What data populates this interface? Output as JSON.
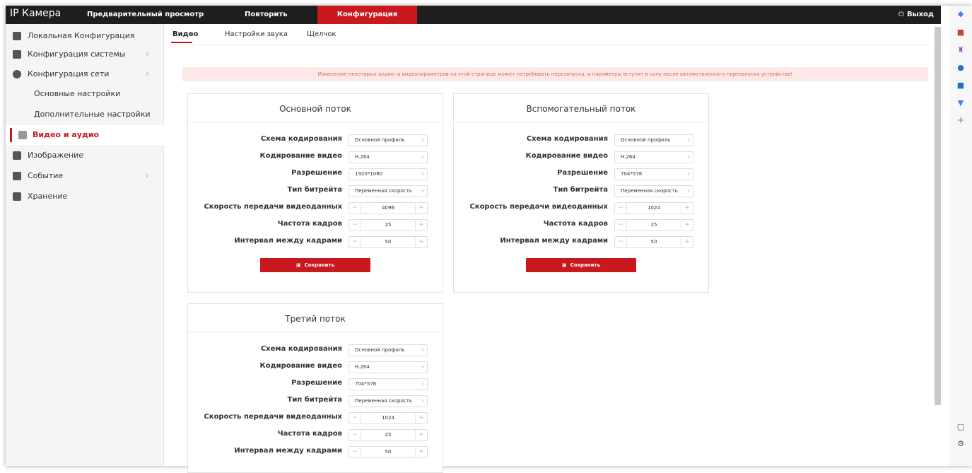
{
  "header": {
    "app_title": "IP Камера",
    "nav": {
      "preview": "Предварительный просмотр",
      "playback": "Повторить",
      "config": "Конфигурация"
    },
    "logout_label": "Выход",
    "logout_icon": "power-icon"
  },
  "sidebar": {
    "items": [
      {
        "label": "Локальная Конфигурация",
        "icon": "monitor-icon"
      },
      {
        "label": "Конфигурация системы",
        "icon": "system-icon"
      },
      {
        "label": "Конфигурация сети",
        "icon": "globe-icon"
      },
      {
        "label": "Основные настройки"
      },
      {
        "label": "Дополнительные настройки"
      },
      {
        "label": "Видео и аудио",
        "icon": "video-audio-icon"
      },
      {
        "label": "Изображение",
        "icon": "image-icon"
      },
      {
        "label": "Событие",
        "icon": "event-icon"
      },
      {
        "label": "Хранение",
        "icon": "storage-icon"
      }
    ],
    "chevron_down": "∨",
    "chevron_up": "∧"
  },
  "tabs": {
    "video": "Видео",
    "audio": "Настройки звука",
    "snapshot": "Щелчок"
  },
  "warning": "Изменение некоторых аудио- и видеопараметров на этой странице может потребовать перезапуска, и параметры вступят в силу после автоматического перезапуска устройства!",
  "labels": {
    "encoding_scheme": "Схема кодирования",
    "video_encoding": "Кодирование видео",
    "resolution": "Разрешение",
    "bitrate_type": "Тип битрейта",
    "bitrate": "Скорость передачи видеоданных",
    "framerate": "Частота кадров",
    "iframe_interval": "Интервал между кадрами",
    "save": "Сохранить",
    "minus": "−",
    "plus": "+",
    "caret": "∨"
  },
  "streams": {
    "main": {
      "title": "Основной поток",
      "encoding_scheme": "Основной профиль",
      "video_encoding": "H.264",
      "resolution": "1920*1080",
      "bitrate_type": "Переменная скорость",
      "bitrate": "4096",
      "framerate": "25",
      "iframe_interval": "50"
    },
    "sub": {
      "title": "Вспомогательный поток",
      "encoding_scheme": "Основной профиль",
      "video_encoding": "H.264",
      "resolution": "704*576",
      "bitrate_type": "Переменная скорость",
      "bitrate": "1024",
      "framerate": "25",
      "iframe_interval": "50"
    },
    "third": {
      "title": "Третий поток",
      "encoding_scheme": "Основной профиль",
      "video_encoding": "H.264",
      "resolution": "704*576",
      "bitrate_type": "Переменная скорость",
      "bitrate": "1024",
      "framerate": "25",
      "iframe_interval": "50"
    }
  },
  "colors": {
    "accent": "#c9191f",
    "topbar": "#1e1e1e",
    "warning_bg": "#fde8e8",
    "warning_text": "#e06060"
  }
}
